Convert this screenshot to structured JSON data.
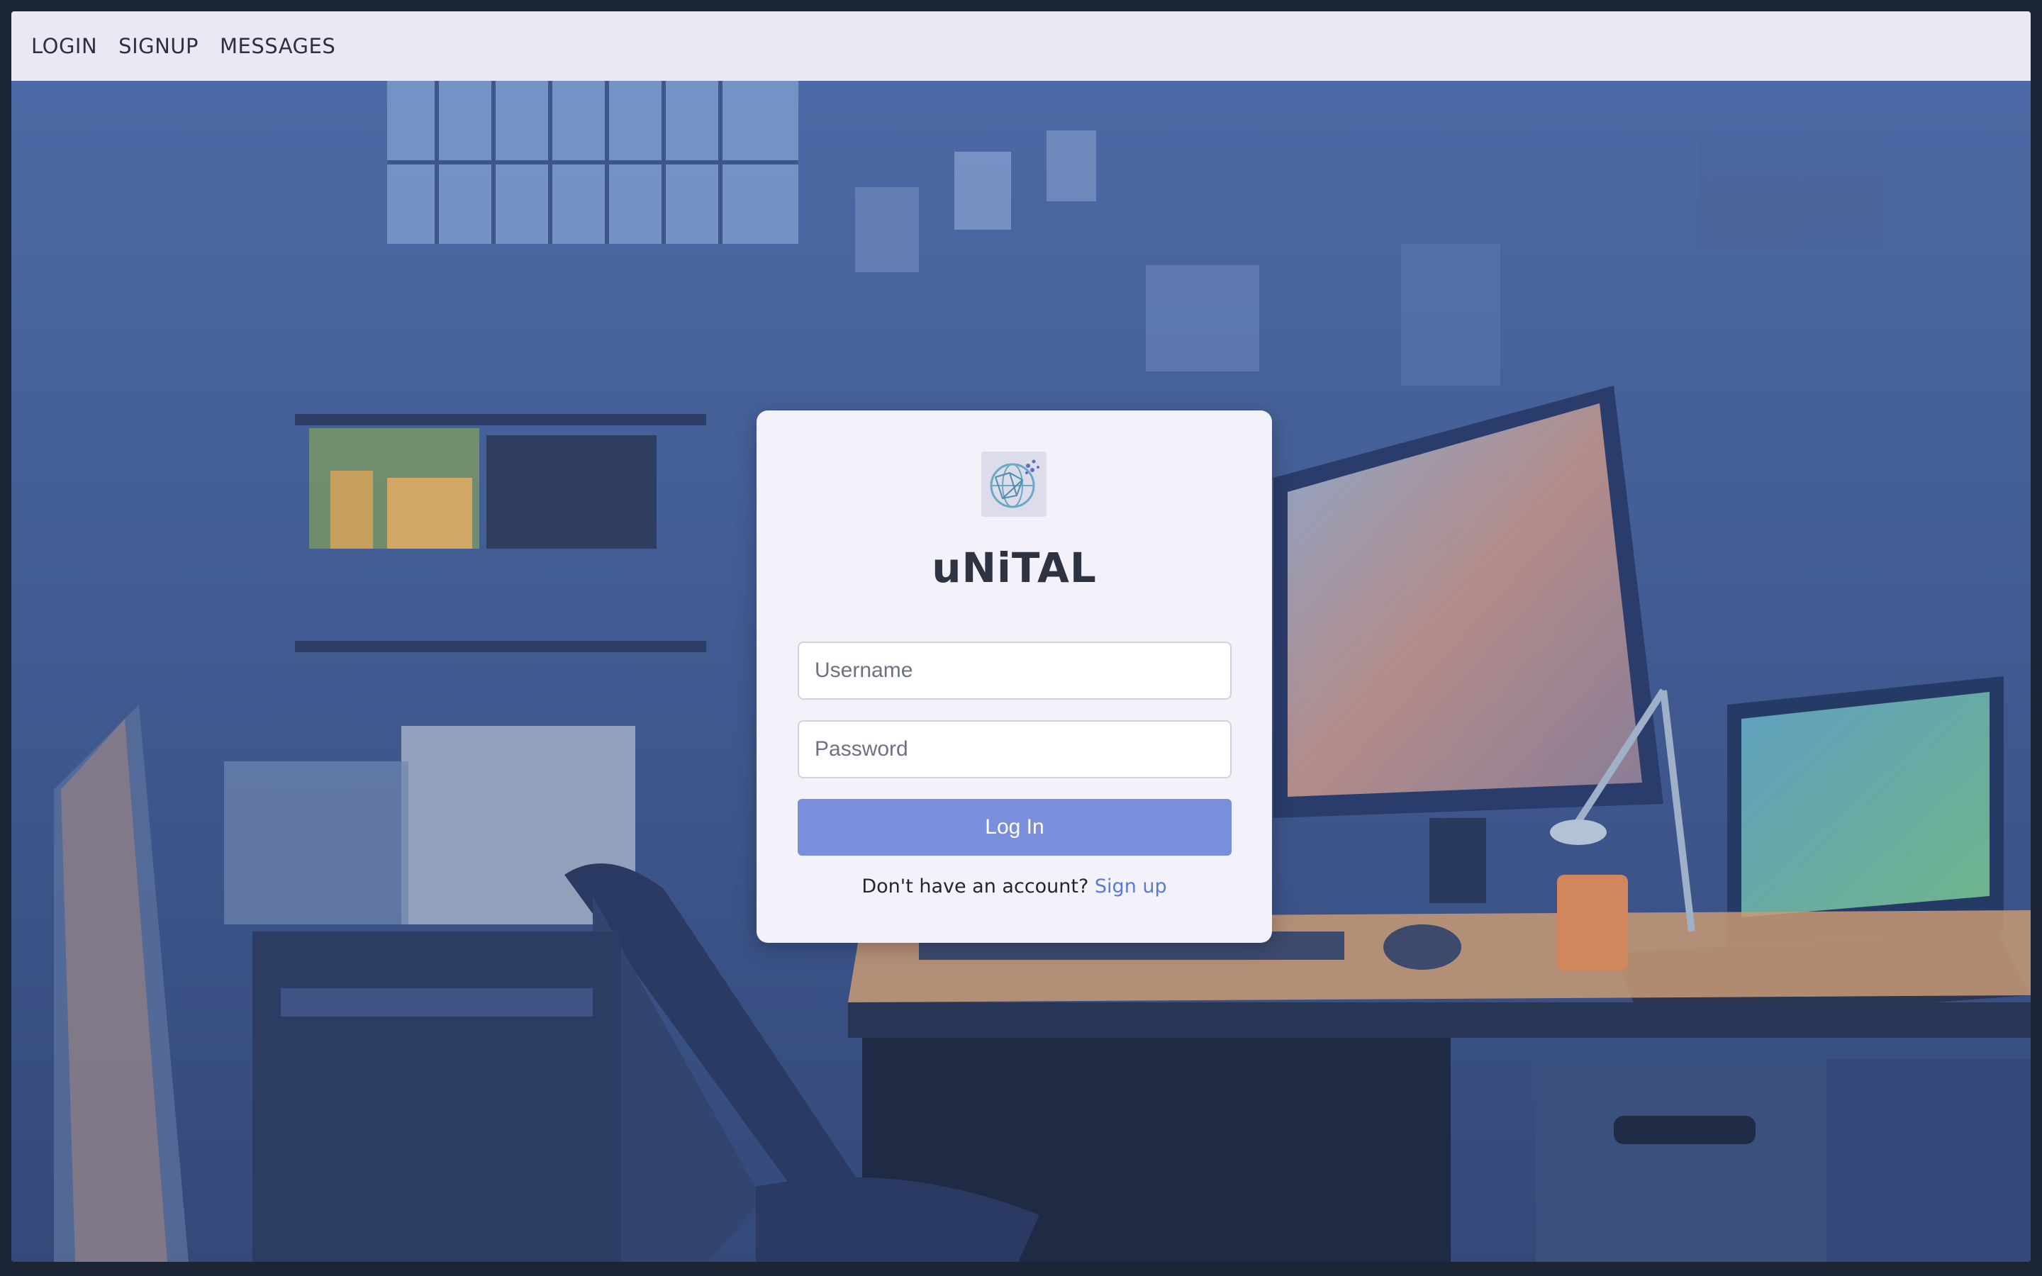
{
  "nav": {
    "items": [
      "LOGIN",
      "SIGNUP",
      "MESSAGES"
    ]
  },
  "login_card": {
    "brand": "uNiTAL",
    "logo_icon": "globe-network-icon",
    "username_placeholder": "Username",
    "password_placeholder": "Password",
    "submit_label": "Log In",
    "signup_prompt": "Don't have an account?",
    "signup_link": "Sign up"
  },
  "background": {
    "icon": "cluttered-workshop-desk-illustration"
  },
  "colors": {
    "navbar_bg": "#ebe8f4",
    "card_bg": "#f3f2fb",
    "button_bg": "#7a8fdc",
    "link": "#5b7ad6",
    "scene_base": "#3d5587"
  }
}
